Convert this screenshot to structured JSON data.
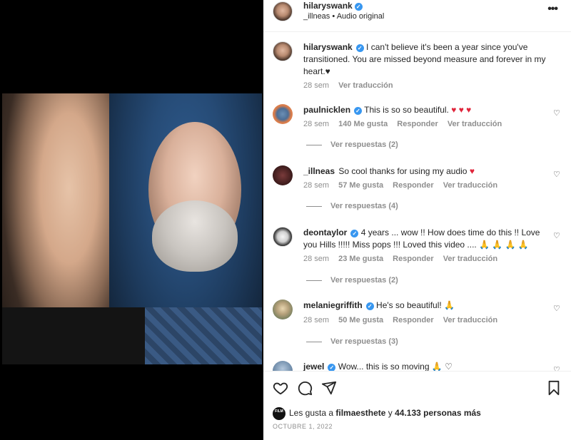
{
  "post": {
    "author": "hilaryswank",
    "audio_user": "_illneas",
    "audio_sep": "•",
    "audio_label": "Audio original",
    "more_label": "•••"
  },
  "caption": {
    "user": "hilaryswank",
    "text": "I can't believe it's been a year since you've transitioned. You are missed beyond measure and forever in my heart.♥",
    "time": "28 sem",
    "translate": "Ver traducción"
  },
  "comments": [
    {
      "user": "paulnicklen",
      "verified": true,
      "text": "This is so so beautiful.",
      "emoji": "♥ ♥ ♥",
      "time": "28 sem",
      "likes": "140 Me gusta",
      "reply": "Responder",
      "translate": "Ver traducción",
      "replies": "Ver respuestas (2)"
    },
    {
      "user": "_illneas",
      "verified": false,
      "text": "So cool thanks for using my audio",
      "emoji": "♥",
      "time": "28 sem",
      "likes": "57 Me gusta",
      "reply": "Responder",
      "translate": "Ver traducción",
      "replies": "Ver respuestas (4)"
    },
    {
      "user": "deontaylor",
      "verified": true,
      "text": "4 years ... wow !! How does time do this !! Love you Hills !!!!! Miss pops !!! Loved this video ....",
      "emoji": "🙏 🙏 🙏 🙏",
      "time": "28 sem",
      "likes": "23 Me gusta",
      "reply": "Responder",
      "translate": "Ver traducción",
      "replies": "Ver respuestas (2)"
    },
    {
      "user": "melaniegriffith",
      "verified": true,
      "text": "He's so beautiful!",
      "emoji": "🙏",
      "time": "28 sem",
      "likes": "50 Me gusta",
      "reply": "Responder",
      "translate": "Ver traducción",
      "replies": "Ver respuestas (3)"
    },
    {
      "user": "jewel",
      "verified": true,
      "text": "Wow... this is so moving",
      "emoji": "🙏 ♡"
    }
  ],
  "footer": {
    "likes_prefix": "Les gusta a",
    "likes_user": "filmaesthete",
    "likes_and": "y",
    "likes_count": "44.133 personas más",
    "mini_avatar_text": "FILM",
    "date": "OCTUBRE 1, 2022"
  },
  "icons": {
    "like": "heart-icon",
    "comment": "comment-icon",
    "share": "share-icon",
    "save": "bookmark-icon",
    "verified": "verified-badge-icon"
  },
  "colors": {
    "verified": "#3897f0",
    "heart_red": "#e0243a",
    "meta_gray": "#8e8e8e"
  }
}
